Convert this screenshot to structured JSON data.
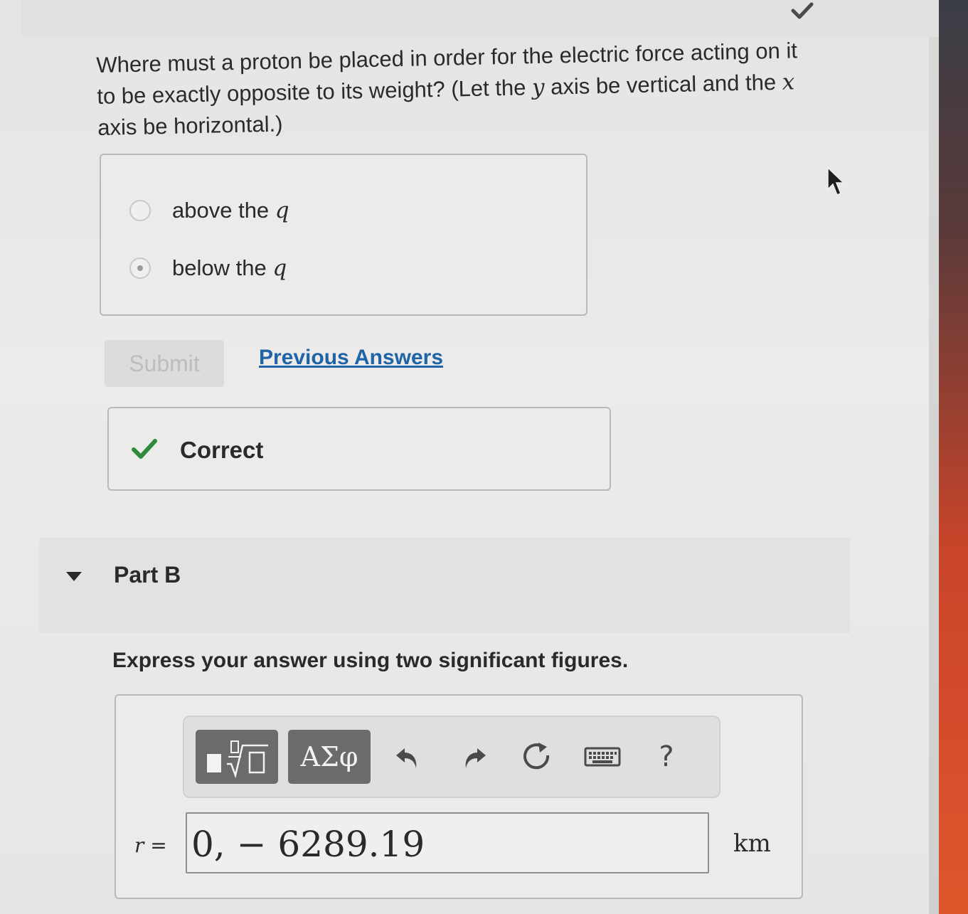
{
  "question": {
    "line1": "Where must a proton be placed in order for the electric force acting on it",
    "line2_pre": "to be exactly opposite to its weight? (Let the ",
    "y_var": "y",
    "line2_mid": " axis be vertical and the ",
    "x_var": "x",
    "line3": "axis be horizontal.)"
  },
  "options": [
    {
      "text": "above the ",
      "var": "q",
      "selected": false
    },
    {
      "text": "below the ",
      "var": "q",
      "selected": true
    }
  ],
  "actions": {
    "submit_label": "Submit",
    "previous_answers_label": "Previous Answers"
  },
  "feedback": {
    "status": "Correct",
    "color": "#2f8a3c"
  },
  "part_b": {
    "title": "Part B",
    "instruction": "Express your answer using two significant figures."
  },
  "toolbar": {
    "templates_icon": "fraction-sqrt-icon",
    "greek_label": "ΑΣφ",
    "undo_icon": "undo-icon",
    "redo_icon": "redo-icon",
    "reset_icon": "reset-icon",
    "keyboard_icon": "keyboard-icon",
    "help_label": "?"
  },
  "answer": {
    "variable": "r",
    "equals": " =",
    "value": "0, − 6289.19",
    "unit": "km"
  }
}
